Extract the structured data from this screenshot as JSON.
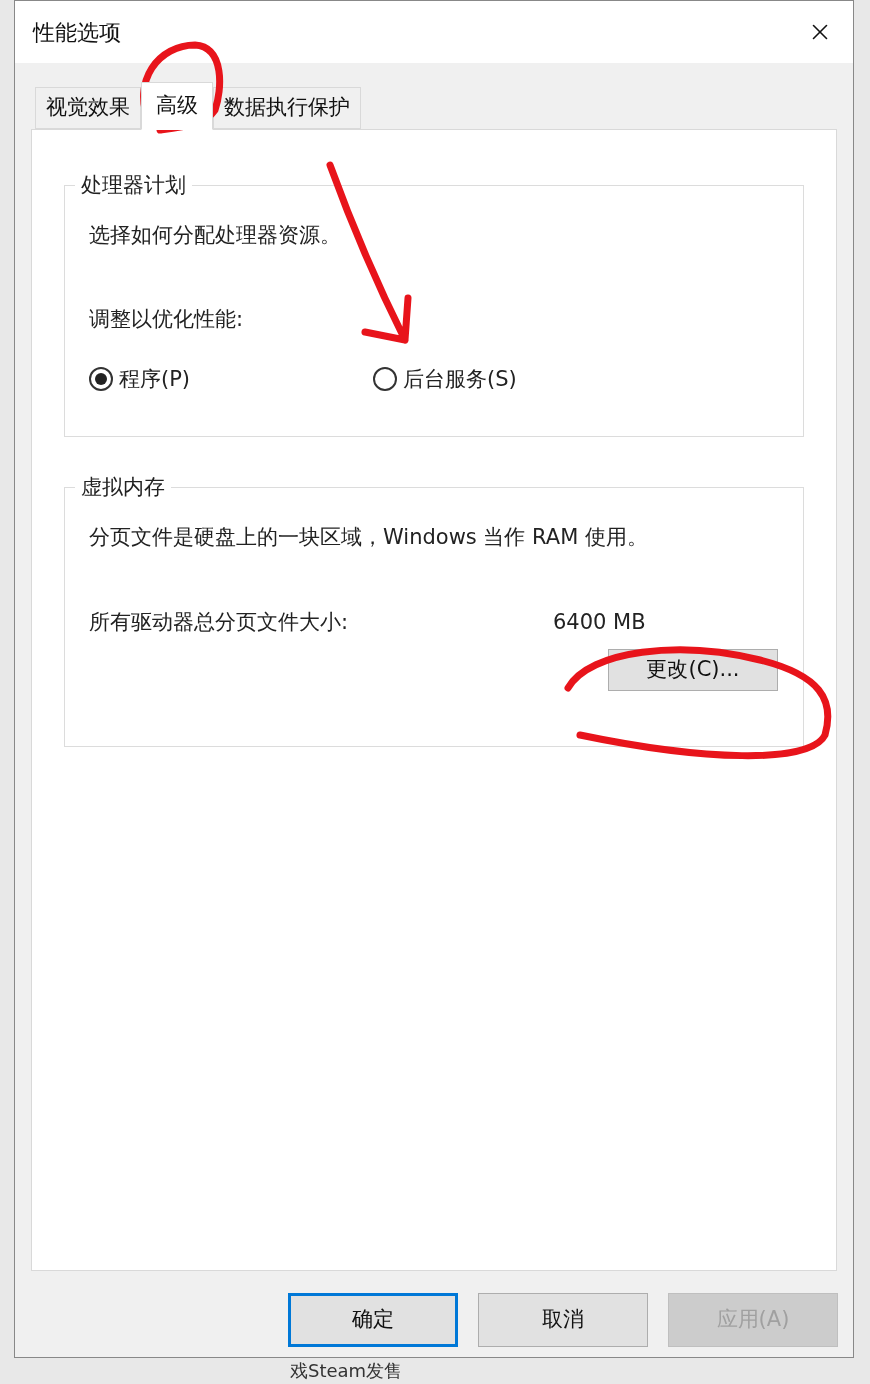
{
  "window": {
    "title": "性能选项"
  },
  "tabs": [
    {
      "label": "视觉效果",
      "selected": false
    },
    {
      "label": "高级",
      "selected": true
    },
    {
      "label": "数据执行保护",
      "selected": false
    }
  ],
  "processor_group": {
    "title": "处理器计划",
    "description": "选择如何分配处理器资源。",
    "adjust_label": "调整以优化性能:",
    "options": [
      {
        "label": "程序(P)",
        "selected": true
      },
      {
        "label": "后台服务(S)",
        "selected": false
      }
    ]
  },
  "memory_group": {
    "title": "虚拟内存",
    "description": "分页文件是硬盘上的一块区域，Windows 当作 RAM 使用。",
    "size_label": "所有驱动器总分页文件大小:",
    "size_value": "6400 MB",
    "change_button": "更改(C)..."
  },
  "buttons": [
    {
      "label": "确定",
      "kind": "default",
      "disabled": false
    },
    {
      "label": "取消",
      "kind": "normal",
      "disabled": false
    },
    {
      "label": "应用(A)",
      "kind": "normal",
      "disabled": true
    }
  ],
  "background_text": "戏Steam发售"
}
